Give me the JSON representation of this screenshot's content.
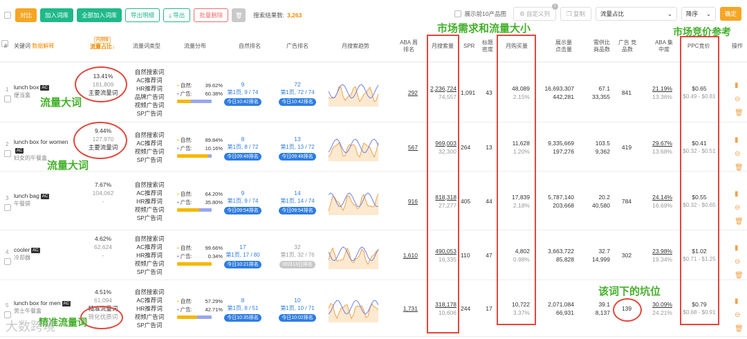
{
  "toolbar": {
    "buttons": [
      "对比",
      "加入词库",
      "全部加入词库",
      "导出明细",
      "导出",
      "批量删除"
    ],
    "search_count_label": "搜索结果数:",
    "search_count": "3,263",
    "show_top10_label": "展示前10产品图",
    "custom_columns": "自定义列",
    "custom_badge": "1",
    "copy": "复制",
    "sort_field": "流量占比",
    "sort_order": "降序",
    "confirm": "确定"
  },
  "header": {
    "index": "#",
    "keyword": "关键词",
    "keyword_link": "数据解释",
    "traffic_tag": "内测版",
    "traffic_share": "流量占比",
    "traffic_type": "流量词类型",
    "traffic_dist": "流量分布",
    "natural_rank": "自然排名",
    "ad_rank": "广告排名",
    "trend": "月搜索趋势",
    "aba_rank": "ABA 周排名",
    "monthly_search": "月搜索量",
    "spr": "SPR",
    "title_density": "标题 密度",
    "monthly_purchase": "月购买量",
    "impressions": "展示量 点击量",
    "supply_demand": "需供比 商品数",
    "ad_products": "广告 竞品数",
    "aba_concentration": "ABA 集中度",
    "ppc": "PPC竞价",
    "action": "操作"
  },
  "rows": [
    {
      "index": "1",
      "keyword": "lunch box",
      "ac": "AC",
      "cn": "便当盒",
      "share": "13.41%",
      "share_num": "181,809",
      "share_label": "主要流量词",
      "share_extra": "-",
      "types": [
        "自然搜索词",
        "AC推荐词",
        "HR推荐词",
        "品牌广告词",
        "视频广告词",
        "SP广告词"
      ],
      "nat_label": "自然:",
      "nat_pct": "39.62%",
      "ad_label": "广告:",
      "ad_pct": "60.38%",
      "nat_share": 0.3962,
      "nat_rank": "9",
      "nat_page": "第1页, 9 / 74",
      "nat_time": "今日10:42排名",
      "ad_rank": "72",
      "ad_page": "第1页, 72 / 74",
      "ad_time": "今日10:42排名",
      "aba": "292",
      "search": "2,236,724",
      "search2": "74,557",
      "spr": "1,091",
      "density": "43",
      "purchase": "48,089",
      "purchase_pct": "2.15%",
      "impr": "16,693,307",
      "clicks": "442,281",
      "sd": "67.1",
      "products": "33,355",
      "ad_comp": "841",
      "aba_conc": "21.19%",
      "aba_conc2": "13.36%",
      "ppc": "$0.65",
      "ppc_range": "$0.49 - $0.81"
    },
    {
      "index": "2",
      "keyword": "lunch box for women",
      "ac": "AC",
      "cn": "妇女的午餐盒",
      "share": "9.44%",
      "share_num": "127,970",
      "share_label": "主要流量词",
      "share_extra": "",
      "types": [
        "自然搜索词",
        "AC推荐词",
        "视频广告词",
        "SP广告词"
      ],
      "nat_label": "自然:",
      "nat_pct": "89.84%",
      "ad_label": "广告:",
      "ad_pct": "10.16%",
      "nat_share": 0.8984,
      "nat_rank": "8",
      "nat_page": "第1页, 8 / 72",
      "nat_time": "今日09:48排名",
      "ad_rank": "13",
      "ad_page": "第1页, 13 / 72",
      "ad_time": "今日09:48排名",
      "aba": "567",
      "search": "969,003",
      "search2": "32,300",
      "spr": "264",
      "density": "13",
      "purchase": "11,628",
      "purchase_pct": "1.20%",
      "impr": "9,335,669",
      "clicks": "197,276",
      "sd": "103.5",
      "products": "9,362",
      "ad_comp": "419",
      "aba_conc": "29.67%",
      "aba_conc2": "13.68%",
      "ppc": "$0.41",
      "ppc_range": "$0.32 - $0.51"
    },
    {
      "index": "3",
      "keyword": "lunch bag",
      "ac": "AC",
      "cn": "午餐袋",
      "share": "7.67%",
      "share_num": "104,062",
      "share_label": "",
      "share_extra": "-",
      "types": [
        "自然搜索词",
        "AC推荐词",
        "HR推荐词",
        "视频广告词",
        "SP广告词"
      ],
      "nat_label": "自然:",
      "nat_pct": "64.20%",
      "ad_label": "广告:",
      "ad_pct": "35.80%",
      "nat_share": 0.642,
      "nat_rank": "9",
      "nat_page": "第1页, 9 / 74",
      "nat_time": "今日09:54排名",
      "ad_rank": "14",
      "ad_page": "第1页, 14 / 74",
      "ad_time": "今日09:54排名",
      "aba": "916",
      "search": "818,318",
      "search2": "27,277",
      "spr": "405",
      "density": "44",
      "purchase": "17,839",
      "purchase_pct": "2.18%",
      "impr": "5,787,140",
      "clicks": "203,668",
      "sd": "20.2",
      "products": "40,580",
      "ad_comp": "784",
      "aba_conc": "24.14%",
      "aba_conc2": "16.69%",
      "ppc": "$0.55",
      "ppc_range": "$0.32 - $0.65"
    },
    {
      "index": "4",
      "keyword": "cooler",
      "ac": "AC",
      "cn": "冷却器",
      "share": "4.62%",
      "share_num": "62,624",
      "share_label": "",
      "share_extra": "-",
      "types": [
        "自然搜索词",
        "AC推荐词",
        "HR推荐词",
        "视频广告词",
        "SP广告词"
      ],
      "nat_label": "自然:",
      "nat_pct": "99.66%",
      "ad_label": "广告:",
      "ad_pct": "0.34%",
      "nat_share": 0.9966,
      "nat_rank": "17",
      "nat_page": "第1页, 17 / 80",
      "nat_time": "今日10:21排名",
      "ad_rank": "32",
      "ad_page": "第1页, 32 / 76",
      "ad_time": "09月13日排名",
      "aba": "1,610",
      "search": "490,053",
      "search2": "16,335",
      "spr": "110",
      "density": "47",
      "purchase": "4,802",
      "purchase_pct": "0.98%",
      "impr": "3,663,722",
      "clicks": "85,828",
      "sd": "32.7",
      "products": "14,999",
      "ad_comp": "302",
      "aba_conc": "23.98%",
      "aba_conc2": "19.34%",
      "ppc": "$1.02",
      "ppc_range": "$0.71 - $1.25"
    },
    {
      "index": "5",
      "keyword": "lunch box for men",
      "ac": "AC",
      "cn": "男士午餐盒",
      "share": "4.51%",
      "share_num": "61,094",
      "share_label": "精准流量词",
      "share_extra": "转化优质词",
      "types": [
        "自然搜索词",
        "AC推荐词",
        "HR推荐词",
        "视频广告词",
        "SP广告词"
      ],
      "nat_label": "自然:",
      "nat_pct": "57.29%",
      "ad_label": "广告:",
      "ad_pct": "42.71%",
      "nat_share": 0.5729,
      "nat_rank": "8",
      "nat_page": "第1页, 8 / 51",
      "nat_time": "今日10:35排名",
      "ad_rank": "10",
      "ad_page": "第1页, 10 / 71",
      "ad_time": "今日10:02排名",
      "aba": "1,731",
      "search": "318,178",
      "search2": "10,606",
      "spr": "244",
      "density": "17",
      "purchase": "10,722",
      "purchase_pct": "3.37%",
      "impr": "2,071,084",
      "clicks": "66,931",
      "sd": "39.1",
      "products": "8,137",
      "ad_comp": "139",
      "aba_conc": "30.09%",
      "aba_conc2": "24.21%",
      "ppc": "$0.79",
      "ppc_range": "$0.68 - $0.91"
    }
  ],
  "annotations": {
    "market_demand": "市场需求和流量大小",
    "competition": "市场竞价参考",
    "big_traffic_1": "流量大词",
    "big_traffic_2": "流量大词",
    "slots": "该词下的坑位",
    "precise": "精准流量词"
  },
  "watermark": "大数跨境",
  "colors": {
    "accent_orange": "#f5a623",
    "accent_green": "#1fb98a",
    "link_blue": "#2f7de1",
    "annotation_red": "#e2463c",
    "annotation_green": "#43b02a",
    "natural_bar": "#f5b800",
    "ad_bar": "#9aa6ee"
  }
}
